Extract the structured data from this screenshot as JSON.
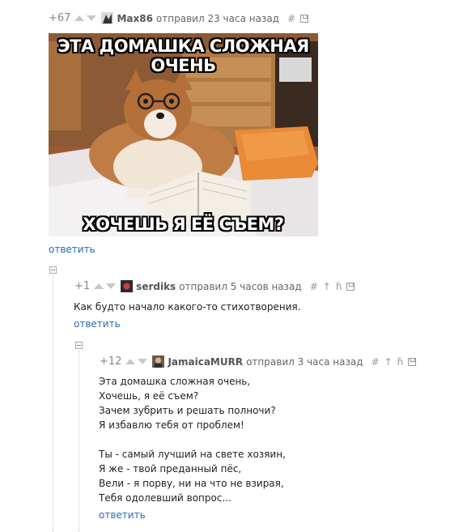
{
  "post": {
    "rating": "+67",
    "author": "Max86",
    "action": "отправил",
    "time": "23 часа назад",
    "hash": "#",
    "image": {
      "top_caption": "ЭТА ДОМАШКА СЛОЖНАЯ ОЧЕНЬ",
      "bottom_caption": "ХОЧЕШЬ Я ЕЁ СЪЕМ?"
    },
    "reply_label": "ответить"
  },
  "comment1": {
    "rating": "+1",
    "author": "serdiks",
    "action": "отправил",
    "time": "5 часов назад",
    "hash": "#",
    "text": "Как будто начало какого-то стихотворения.",
    "reply_label": "ответить"
  },
  "comment2": {
    "rating": "+12",
    "author": "JamaicaMURR",
    "action": "отправил",
    "time": "3 часа назад",
    "hash": "#",
    "lines": [
      "Эта домашка сложная очень,",
      "Хочешь, я её съем?",
      "Зачем зубрить и решать полночи?",
      "Я избавлю тебя от проблем!",
      "Ты - самый лучший на свете хозяин,",
      "Я же - твой преданный пёс,",
      "Вели - я порву, ни на что не взирая,",
      "Тебя одолевший вопрос..."
    ],
    "reply_label": "ответить"
  }
}
